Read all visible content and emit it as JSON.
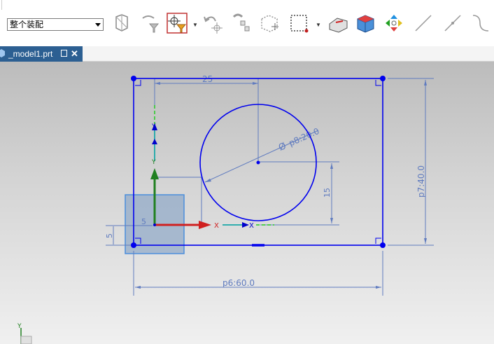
{
  "toolbar": {
    "assembly_select": "整个装配",
    "icons": [
      "view-section-icon",
      "filter-icon",
      "selection-scope-icon",
      "undo-icon",
      "snap-point-icon",
      "component-icon",
      "box-select-icon",
      "rectangle-select-icon",
      "edge-tool-icon",
      "solid-view-icon",
      "navigator-icon",
      "line-tool-icon",
      "line-point-icon",
      "curve-tool-icon"
    ]
  },
  "tab": {
    "title": "_model1.prt"
  },
  "sketch": {
    "dimensions": {
      "width_label": "p6:60.0",
      "height_label": "p7:40.0",
      "diameter_label": "p8:20.0",
      "top_offset": "25",
      "circle_vertical": "15",
      "origin_small": "5",
      "left_small": "5"
    },
    "colors": {
      "sketch_line": "#0000ee",
      "dimension": "#5f7bbf",
      "x_axis": "#e02020",
      "y_axis": "#208020",
      "selection_box": "#5b8fd6"
    }
  }
}
